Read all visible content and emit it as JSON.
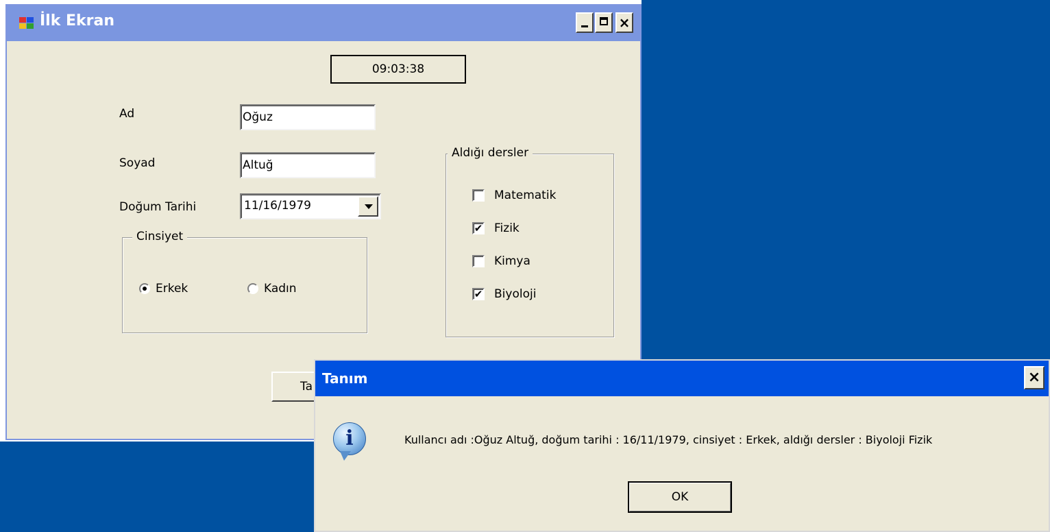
{
  "colors": {
    "desktop": "#0051a0",
    "main_title_bar": "#7b96e0",
    "dialog_title_bar": "#0051e0",
    "window_face": "#ece9d8"
  },
  "main_window": {
    "title": "İlk Ekran",
    "icon": "app-window-icon",
    "caption_buttons": {
      "minimize": "",
      "maximize": "",
      "close": "×"
    },
    "clock": "09:03:38",
    "ad_label": "Ad",
    "ad_value": "Oğuz",
    "soyad_label": "Soyad",
    "soyad_value": "Altuğ",
    "dogum_label": "Doğum Tarihi",
    "dogum_value": "11/16/1979",
    "cinsiyet": {
      "title": "Cinsiyet",
      "options": [
        {
          "label": "Erkek",
          "selected": true
        },
        {
          "label": "Kadın",
          "selected": false
        }
      ]
    },
    "dersler": {
      "title": "Aldığı dersler",
      "items": [
        {
          "label": "Matematik",
          "checked": false,
          "mark": ""
        },
        {
          "label": "Fizik",
          "checked": true,
          "mark": "✔"
        },
        {
          "label": "Kimya",
          "checked": false,
          "mark": ""
        },
        {
          "label": "Biyoloji",
          "checked": true,
          "mark": "✔"
        }
      ]
    },
    "button_partial_label": "Ta"
  },
  "dialog": {
    "title": "Tanım",
    "close": "×",
    "icon": "info-icon",
    "icon_glyph": "i",
    "message": "Kullancı adı :Oğuz Altuğ, doğum tarihi : 16/11/1979, cinsiyet : Erkek, aldığı dersler : Biyoloji Fizik",
    "ok_label": "OK"
  }
}
